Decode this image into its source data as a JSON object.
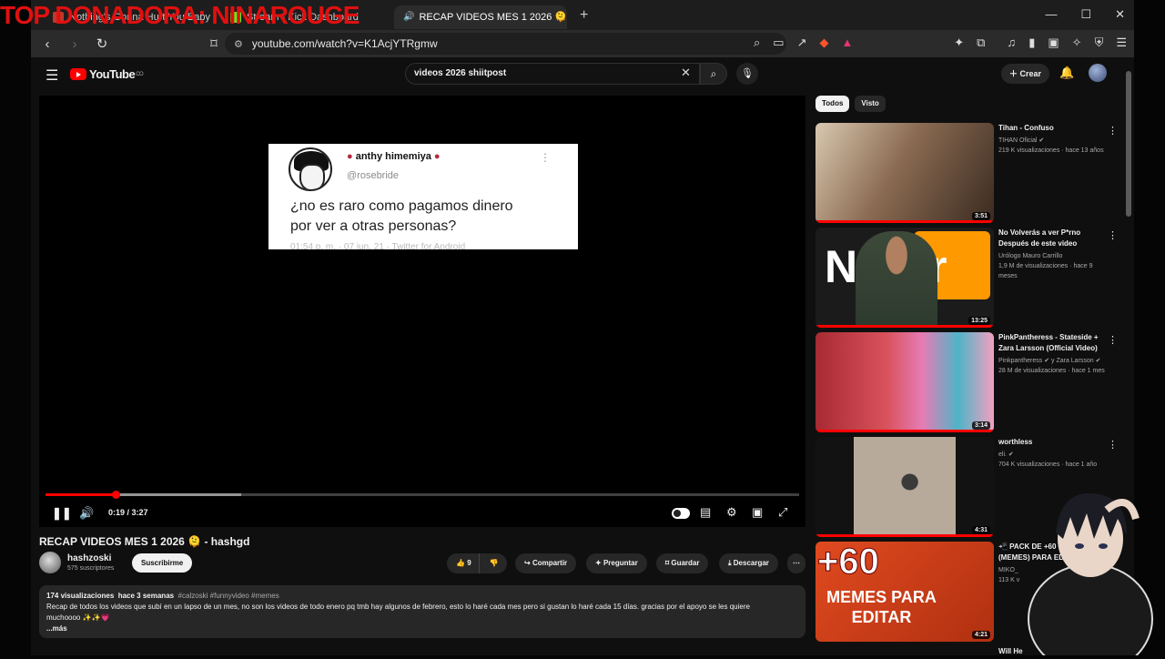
{
  "overlay": {
    "text": "TOP DONADORA: NINAROUGE"
  },
  "browser": {
    "tabs": [
      {
        "label": "Nothing's Gonna Hurt You Baby",
        "color": "#c0392b",
        "active": false
      },
      {
        "label": "Stream - Kick Dashboard",
        "color": "#53fc18",
        "active": false
      },
      {
        "label": "RECAP VIDEOS MES 1 2026 🫠",
        "color": "#ff0000",
        "active": true
      }
    ],
    "url": "youtube.com/watch?v=K1AcjYTRgmw"
  },
  "youtube": {
    "logo": "YouTube",
    "logo_sup": "CO",
    "search_value": "videos 2026 shiitpost",
    "create_label": "Crear"
  },
  "player": {
    "tweet_name": "anthy himemiya",
    "tweet_handle": "@rosebride",
    "tweet_line1": "¿no es raro como pagamos dinero",
    "tweet_line2": "por ver a otras personas?",
    "tweet_footer": "01:54 p. m. · 07 jun. 21 · Twitter for Android",
    "time": "0:19 / 3:27",
    "progress": 0.093,
    "buffered": 0.26
  },
  "video": {
    "title": "RECAP VIDEOS MES 1 2026 🫠 - hashgd",
    "channel": "hashzoski",
    "subs": "575 suscriptores",
    "subscribe": "Suscribirme",
    "likes": "9",
    "share": "Compartir",
    "ask": "Preguntar",
    "save": "Guardar",
    "download": "Descargar",
    "views": "174 visualizaciones",
    "ago": "hace 3 semanas",
    "tags": "#calzoski #funnyvideo #memes",
    "desc_line1": "Recap de todos los videos que subí en un lapso de un mes, no son los videos de todo enero pq tmb hay algunos de febrero, esto lo haré cada mes pero si gustan lo haré cada 15 días. gracias por el apoyo se les quiere",
    "desc_line2": "muchoooo ✨✨💗",
    "more": "...más"
  },
  "sidebar": {
    "chips": [
      "Todos",
      "Visto"
    ],
    "items": [
      {
        "title": "Tihan - Confuso",
        "channel": "TIHAN Oficial ✔",
        "meta": "219 K visualizaciones · hace 13 años",
        "duration": "3:51",
        "bg": "#8a6b52",
        "watched": true
      },
      {
        "title": "No Volverás a ver P*rno Después de este video",
        "channel": "Urólogo Mauro Carrillo",
        "meta": "1,9 M de visualizaciones · hace 9 meses",
        "duration": "13:25",
        "bg": "#3a3530",
        "watched": true,
        "thumb_text": "No  or"
      },
      {
        "title": "PinkPantheress - Stateside + Zara Larsson (Official Video)",
        "channel": "Pinkpantheress ✔ y Zara Larsson ✔",
        "meta": "28 M de visualizaciones · hace 1 mes",
        "duration": "3:14",
        "bg": "#c94a57",
        "watched": true
      },
      {
        "title": "worthless",
        "channel": "eli. ✔",
        "meta": "704 K visualizaciones · hace 1 año",
        "duration": "4:31",
        "bg": "#b8aa9a",
        "watched": true
      },
      {
        "title": "📲 PACK DE +60 VIDEOS (MEMES) PARA EDITAR",
        "channel": "MIKO_",
        "meta": "113 K v",
        "duration": "4:21",
        "bg": "#d4401f",
        "watched": false,
        "thumb_text": "+60",
        "thumb_text2": "MEMES PARA EDITAR"
      }
    ],
    "last_title": "Will He"
  }
}
